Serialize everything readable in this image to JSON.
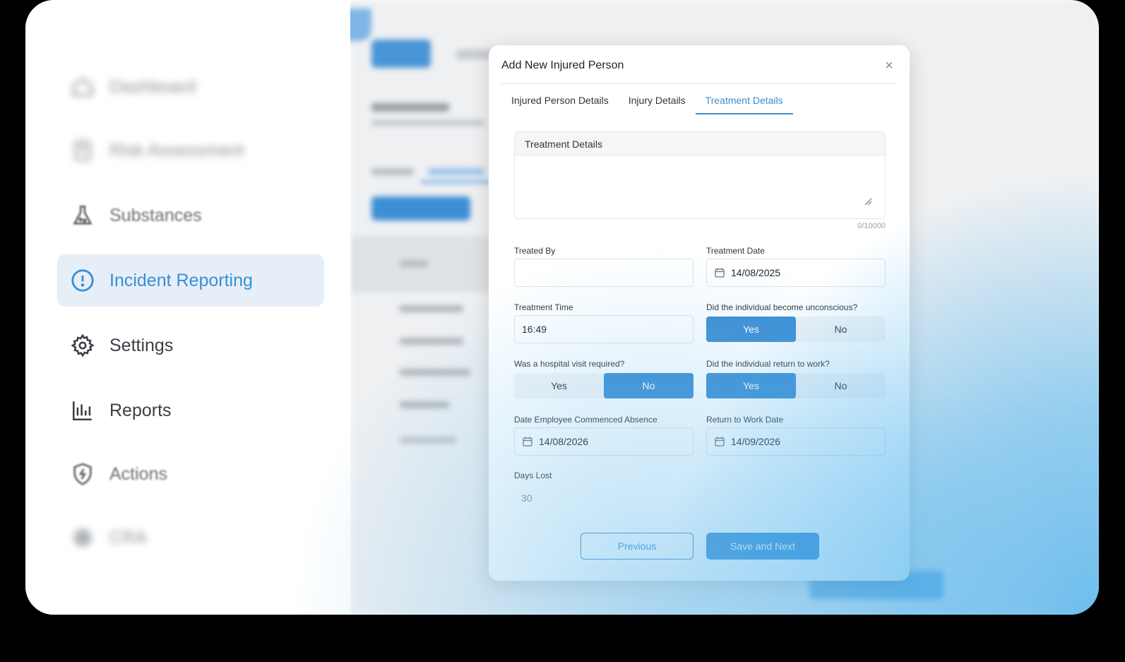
{
  "sidebar": {
    "items": [
      {
        "label": "Dashboard",
        "icon": "dashboard-icon"
      },
      {
        "label": "Risk Assessment",
        "icon": "risk-assessment-icon"
      },
      {
        "label": "Substances",
        "icon": "flask-icon"
      },
      {
        "label": "Incident Reporting",
        "icon": "alert-circle-icon"
      },
      {
        "label": "Settings",
        "icon": "gear-icon"
      },
      {
        "label": "Reports",
        "icon": "bar-chart-icon"
      },
      {
        "label": "Actions",
        "icon": "shield-bolt-icon"
      },
      {
        "label": "CRA",
        "icon": "cog-icon"
      }
    ],
    "active_color": "#3a8fd1"
  },
  "modal": {
    "title": "Add New Injured Person",
    "close_glyph": "×",
    "tabs": [
      {
        "label": "Injured Person Details"
      },
      {
        "label": "Injury Details"
      },
      {
        "label": "Treatment Details"
      }
    ],
    "treatment_details": {
      "label": "Treatment Details",
      "value": "",
      "counter": "0/10000"
    },
    "treated_by": {
      "label": "Treated By",
      "value": ""
    },
    "treatment_date": {
      "label": "Treatment Date",
      "value": "14/08/2025"
    },
    "treatment_time": {
      "label": "Treatment Time",
      "value": "16:49"
    },
    "unconscious": {
      "label": "Did the individual become unconscious?",
      "yes": "Yes",
      "no": "No",
      "selected": "Yes"
    },
    "hospital": {
      "label": "Was a hospital visit required?",
      "yes": "Yes",
      "no": "No",
      "selected": "No"
    },
    "return_work": {
      "label": "Did the individual return to work?",
      "yes": "Yes",
      "no": "No",
      "selected": "Yes"
    },
    "absence_date": {
      "label": "Date Employee Commenced Absence",
      "value": "14/08/2026"
    },
    "return_date": {
      "label": "Return to Work Date",
      "value": "14/09/2026"
    },
    "days_lost": {
      "label": "Days Lost",
      "value": "30"
    },
    "buttons": {
      "previous": "Previous",
      "next": "Save and Next"
    },
    "accent": "#3d8fd4"
  }
}
